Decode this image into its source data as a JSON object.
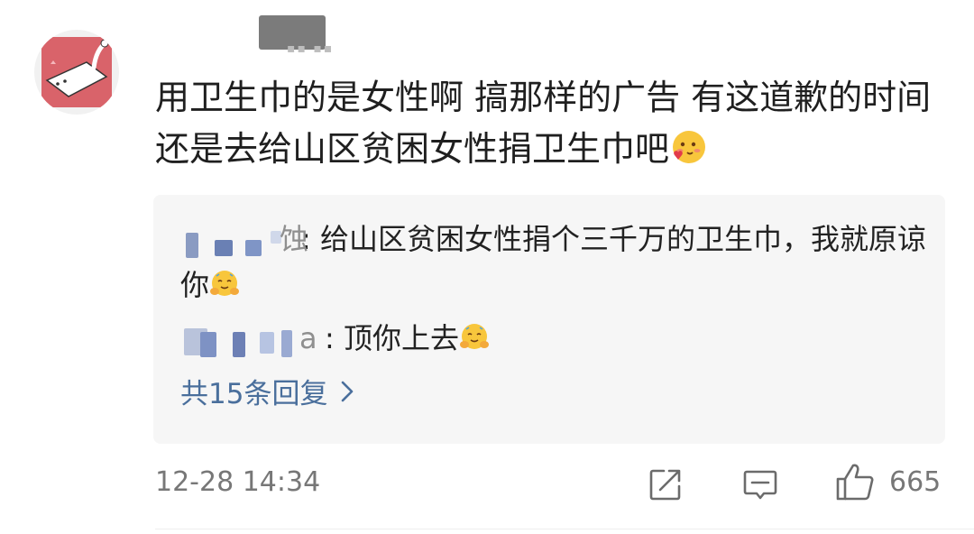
{
  "comment": {
    "text": "用卫生巾的是女性啊 搞那样的广告 有这道歉的时间还是去给山区贫困女性捐卫生巾吧",
    "emoji": "face-with-heart-emoji",
    "time": "12-28 14:34",
    "like_count": "665"
  },
  "replies": [
    {
      "name_tail": "蚀",
      "text": ": 给山区贫困女性捐个三千万的卫生巾，我就原谅你",
      "emoji": "hugging-face-emoji"
    },
    {
      "name_tail": "a",
      "text": ": 顶你上去",
      "emoji": "hugging-face-emoji"
    }
  ],
  "more_replies": {
    "label": "共15条回复",
    "chevron": ">"
  },
  "colors": {
    "link": "#4a6f9c",
    "reply_bg": "#f6f6f6",
    "meta": "#777777",
    "avatar_bg": "#d9636a"
  }
}
